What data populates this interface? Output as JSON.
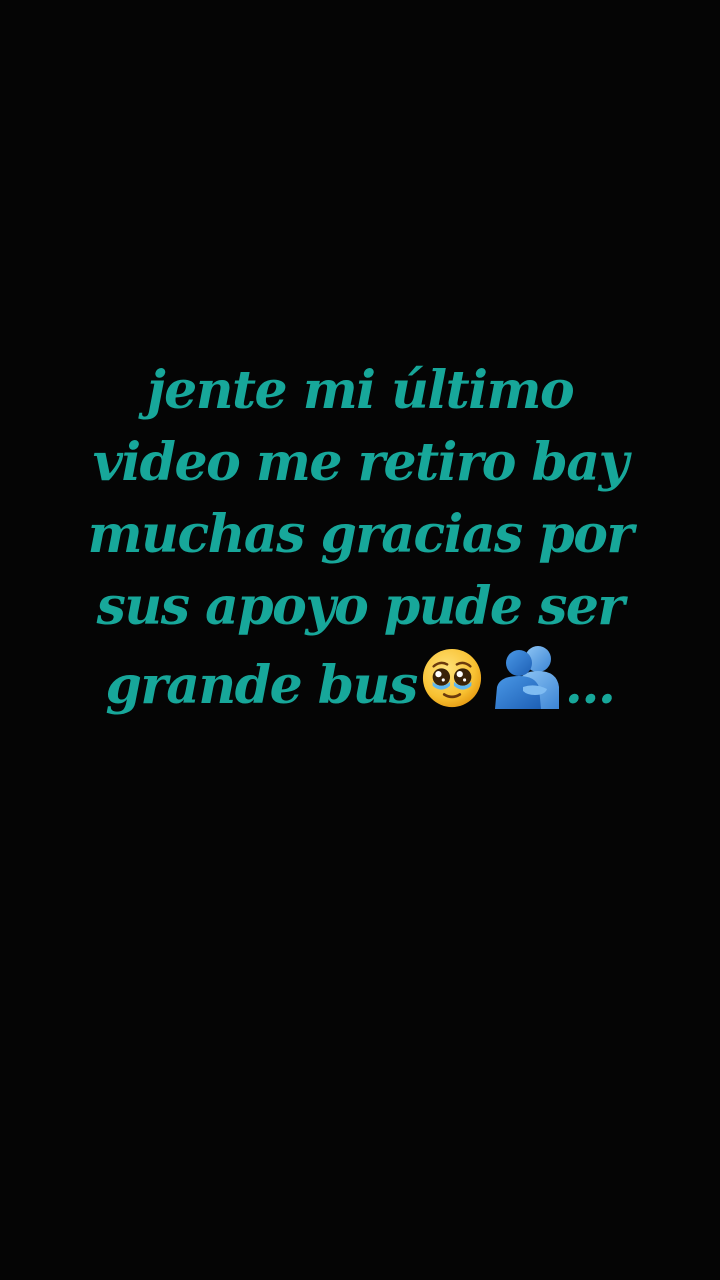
{
  "caption": {
    "lines": [
      "jente mi último",
      "video me retiro bay",
      "muchas gracias por",
      "sus apoyo pude ser"
    ],
    "last_line_text": "grande bus",
    "ellipsis": "...",
    "emojis": [
      "pleading-face-with-tear-icon",
      "people-hugging-icon"
    ],
    "color": "#17a79a"
  },
  "background_color": "#050505"
}
